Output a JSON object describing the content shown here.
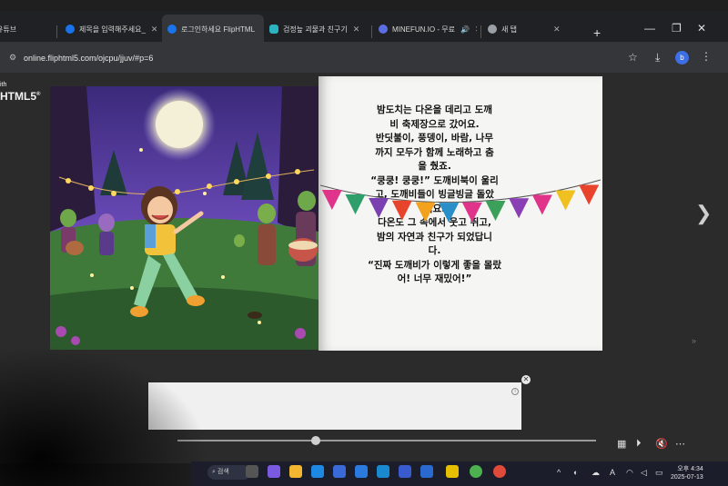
{
  "browser": {
    "tabs": [
      {
        "label": "유튜브",
        "color": "#e53935"
      },
      {
        "label": "제목을 입력해주세요_",
        "color": "#1a73e8"
      },
      {
        "label": "로그인하세요 FlipHTML",
        "color": "#1a73e8"
      },
      {
        "label": "검정늪 괴물과 친구기",
        "color": "#2bb3c0"
      },
      {
        "label": "MINEFUN.IO - 무료",
        "color": "#5b6ee1"
      },
      {
        "label": "새 탭",
        "color": "#9aa0a6"
      }
    ],
    "url": "online.fliphtml5.com/ojcpu/jjuv/#p=6",
    "avatar_letter": "b"
  },
  "viewer": {
    "logo_top": "ith",
    "logo_main": "HTML5",
    "logo_reg": "®",
    "story_lines": [
      "밤도치는 다온을 데리고 도깨",
      "비 축제장으로 갔어요.",
      "반딧불이, 풍뎅이, 바람, 나무",
      "까지 모두가 함께 노래하고 춤",
      "을 췄죠.",
      "“쿵쿵! 쿵쿵!” 도깨비북이 울리",
      "고, 도깨비들이 빙글빙글 돌았",
      "어요.",
      "다온도 그 속에서 웃고 뛰고,",
      "밤의 자연과 친구가 되었답니",
      "다.",
      "“진짜 도깨비가 이렇게 좋을 몰랐",
      "어! 너무 재밌어!”"
    ],
    "bunting_colors": [
      "#e0338a",
      "#2e9e6a",
      "#7a3fb0",
      "#e8442c",
      "#f2a21c",
      "#2a8fc8",
      "#e0338a",
      "#3aa05a",
      "#8a3fb5",
      "#e0338a",
      "#f0c020",
      "#e8442c"
    ],
    "progress_fraction": 0.33
  },
  "taskbar": {
    "search_label": "검색",
    "time": "오후 4:34",
    "date": "2025-07-13",
    "ime": "A"
  }
}
